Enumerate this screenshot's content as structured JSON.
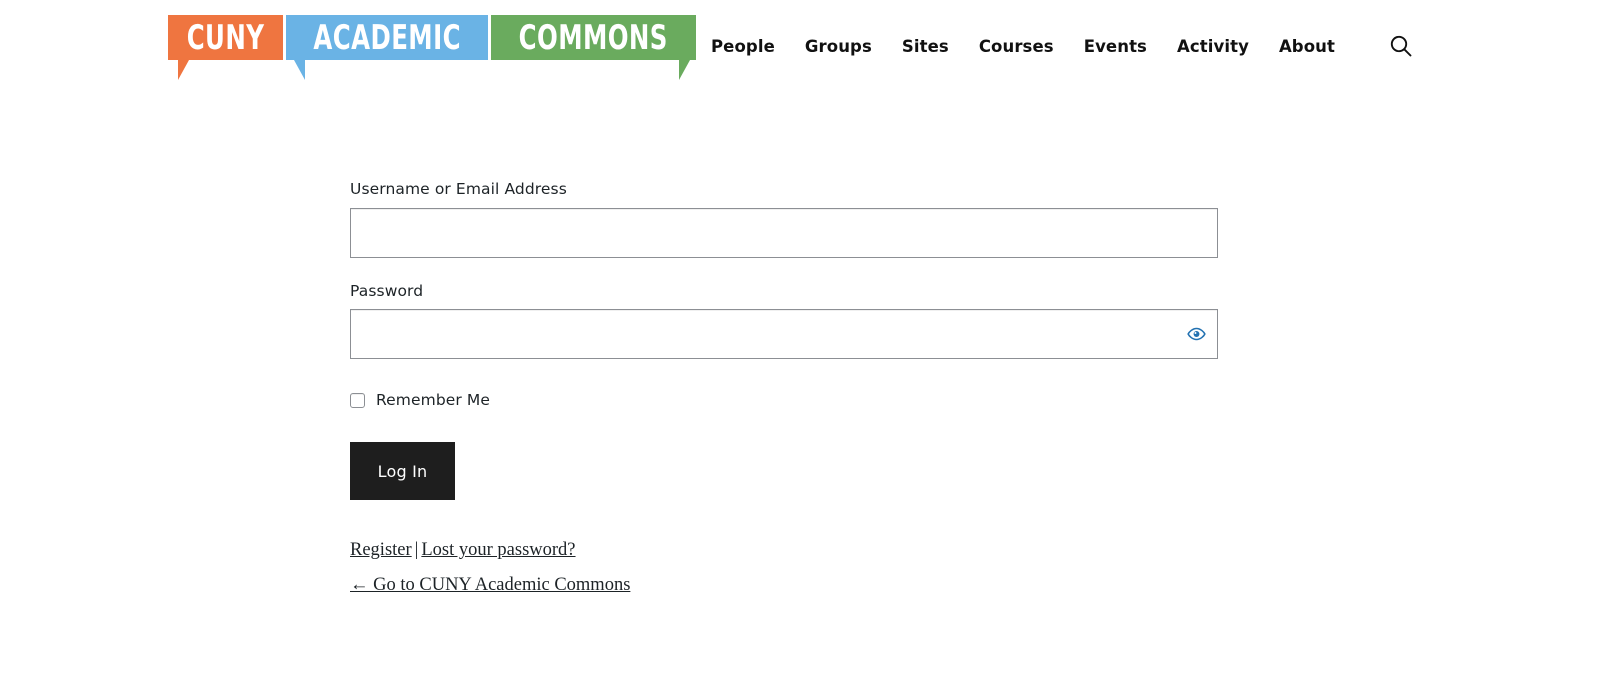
{
  "site": {
    "name": "CUNY Academic Commons",
    "logo": {
      "blocks": [
        {
          "text": "CUNY",
          "color": "#ef7540",
          "tail": "down-right"
        },
        {
          "text": "ACADEMIC",
          "color": "#6ab3e5",
          "tail": "down-left"
        },
        {
          "text": "COMMONS",
          "color": "#6aab5e",
          "tail": "down-right"
        }
      ]
    }
  },
  "nav": {
    "items": [
      {
        "label": "People"
      },
      {
        "label": "Groups"
      },
      {
        "label": "Sites"
      },
      {
        "label": "Courses"
      },
      {
        "label": "Events"
      },
      {
        "label": "Activity"
      },
      {
        "label": "About"
      }
    ],
    "search_icon": "search-icon"
  },
  "login": {
    "username": {
      "label": "Username or Email Address",
      "value": "",
      "placeholder": ""
    },
    "password": {
      "label": "Password",
      "value": "",
      "placeholder": "",
      "toggle_icon": "eye-icon",
      "toggle_color": "#2271b1"
    },
    "remember": {
      "label": "Remember Me",
      "checked": false
    },
    "submit_label": "Log In",
    "links": {
      "register": "Register",
      "separator": "|",
      "lost_password": "Lost your password?",
      "back": "← Go to CUNY Academic Commons"
    }
  }
}
